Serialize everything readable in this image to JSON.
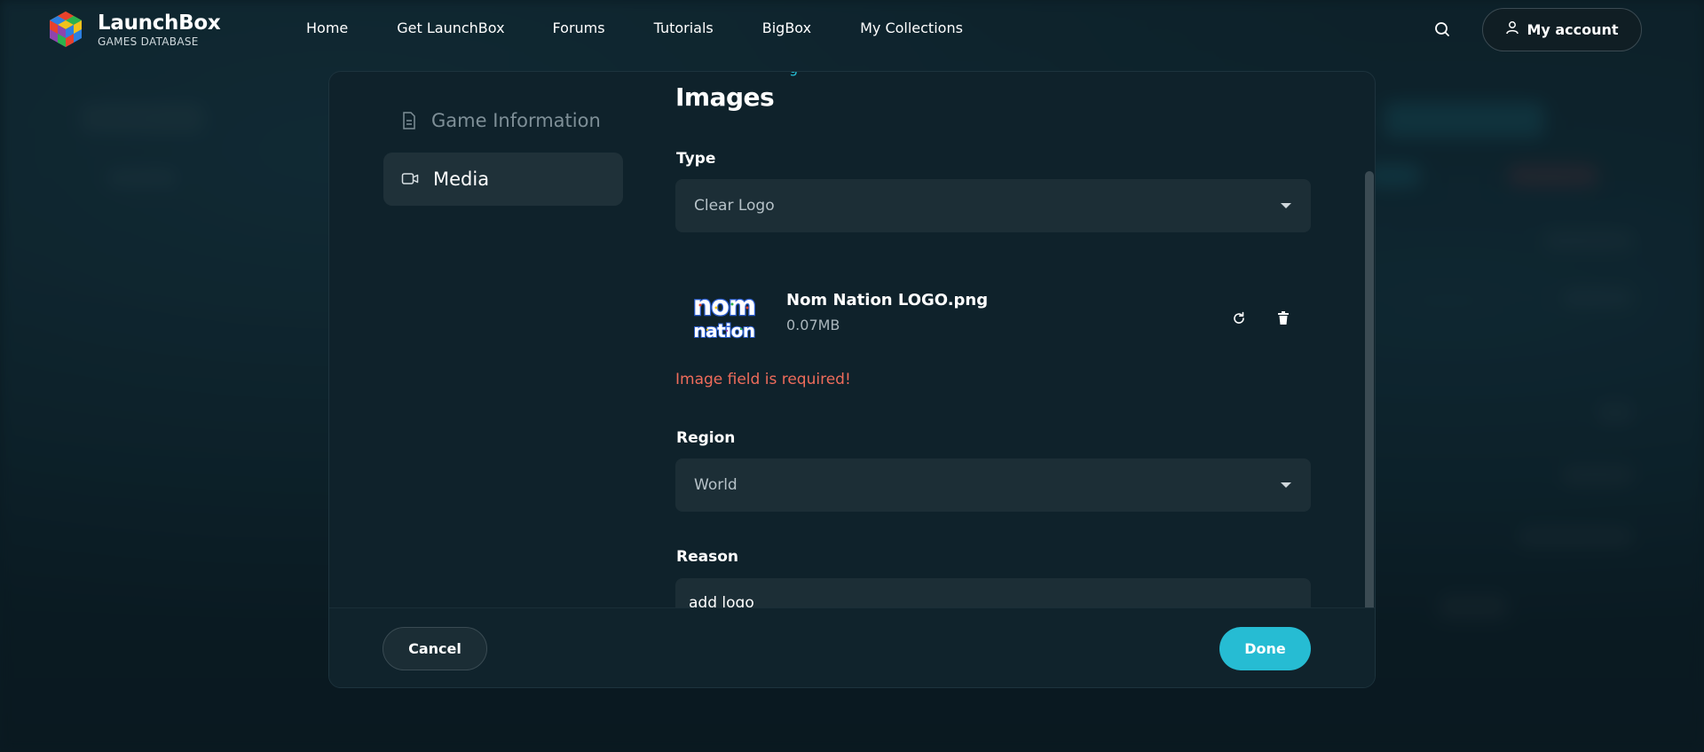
{
  "brand": {
    "title": "LaunchBox",
    "subtitle": "GAMES DATABASE"
  },
  "nav": {
    "links": [
      "Home",
      "Get LaunchBox",
      "Forums",
      "Tutorials",
      "BigBox",
      "My Collections"
    ],
    "account_label": "My account",
    "search_icon": "search-icon",
    "account_icon": "user-icon"
  },
  "sidebar": {
    "items": [
      {
        "label": "Game Information",
        "icon": "document-icon",
        "active": false
      },
      {
        "label": "Media",
        "icon": "video-camera-icon",
        "active": true
      }
    ]
  },
  "form": {
    "partial_link": "g",
    "section_title": "Images",
    "type": {
      "label": "Type",
      "value": "Clear Logo"
    },
    "file": {
      "name": "Nom Nation LOGO.png",
      "size": "0.07MB",
      "thumb_text_line1": "nom",
      "thumb_text_line2": "nation"
    },
    "error": "Image field is required!",
    "region": {
      "label": "Region",
      "value": "World"
    },
    "reason": {
      "label": "Reason",
      "value": "add logo"
    }
  },
  "footer": {
    "cancel_label": "Cancel",
    "done_label": "Done"
  },
  "colors": {
    "accent": "#26bcd3",
    "error": "#ef6c5b",
    "background": "#0c1f28",
    "modal": "#0f222b"
  }
}
